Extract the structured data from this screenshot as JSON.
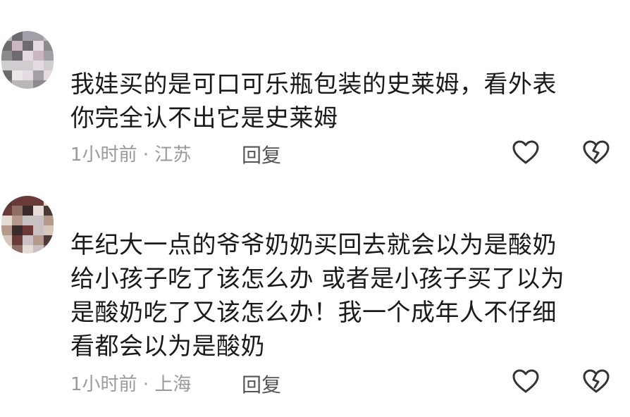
{
  "comments": [
    {
      "avatar_palette": [
        "#b8b8b8",
        "#d0cdd0",
        "#8c8a8c",
        "#ece6ea",
        "#c9b6c2",
        "#6e6a70",
        "#e3dbe1",
        "#a39fa6"
      ],
      "lines": [
        "我娃买的是可口可乐瓶包装的史莱姆，看外表",
        "你完全认不出它是史莱姆"
      ],
      "time": "1小时前",
      "separator": "·",
      "location": "江苏",
      "reply_label": "回复"
    },
    {
      "avatar_palette": [
        "#c9c0c4",
        "#6b3a38",
        "#b59a8c",
        "#3a2a2a",
        "#d8c7bd",
        "#8e6f66",
        "#e6dcd6",
        "#4c3a38"
      ],
      "lines": [
        "年纪大一点的爷爷奶奶买回去就会以为是酸奶",
        "给小孩子吃了该怎么办 或者是小孩子买了以为",
        "是酸奶吃了又该怎么办！我一个成年人不仔细",
        "看都会以为是酸奶"
      ],
      "time": "1小时前",
      "separator": "·",
      "location": "上海",
      "reply_label": "回复"
    }
  ],
  "icons": {
    "like": "heart-outline-icon",
    "dislike": "broken-heart-icon"
  },
  "colors": {
    "text": "#1a1a1a",
    "meta": "#9a9a9a",
    "icon": "#333333"
  }
}
